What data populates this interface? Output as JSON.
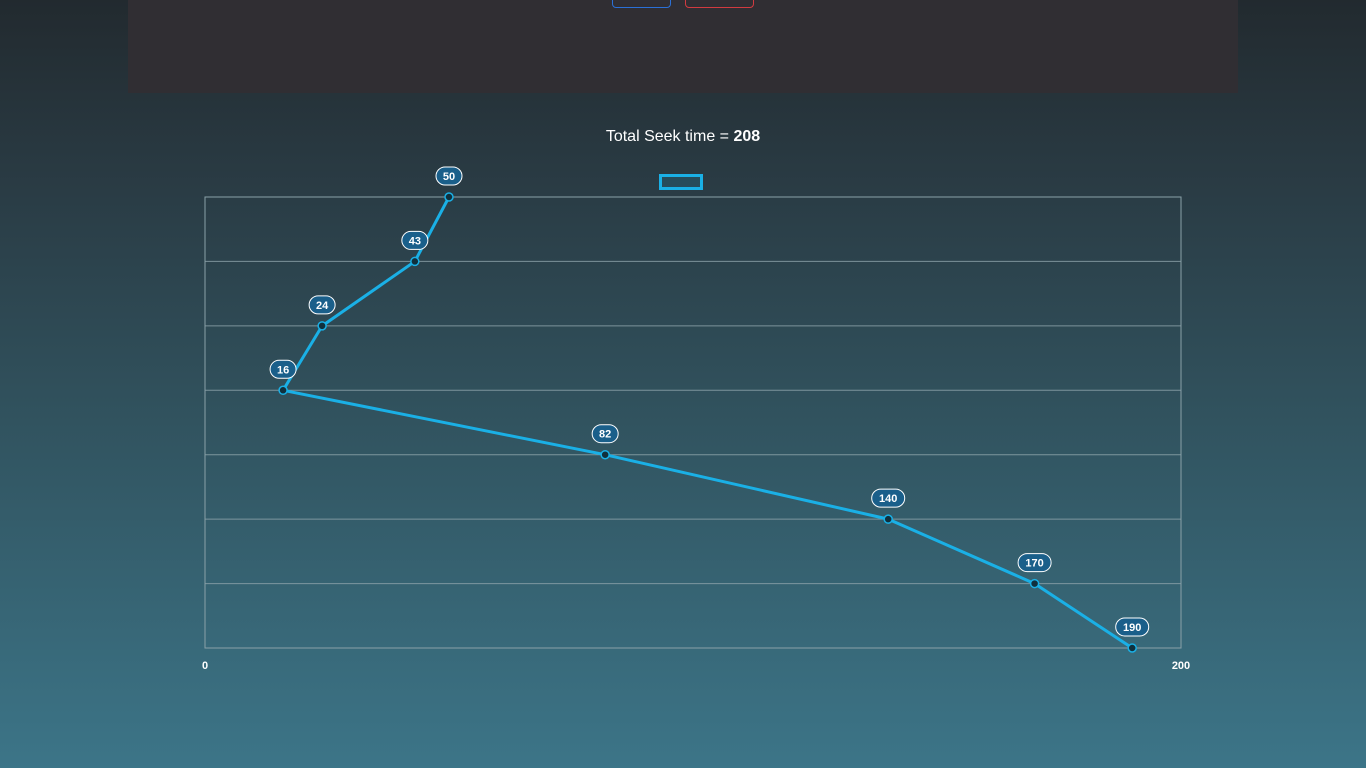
{
  "header": {
    "total_label": "Total Seek time = ",
    "total_value": "208"
  },
  "colors": {
    "line": "#1ab0e6",
    "label_bg": "#1a5f8a",
    "grid": "#8aa1a8",
    "point": "#10303d"
  },
  "chart_data": {
    "type": "line",
    "title": "",
    "xlabel": "",
    "ylabel": "",
    "xlim": [
      0,
      200
    ],
    "x_ticks": [
      "0",
      "200"
    ],
    "grid": true,
    "legend": "top-center",
    "series": [
      {
        "points": [
          {
            "step": 0,
            "x": 50
          },
          {
            "step": 1,
            "x": 43
          },
          {
            "step": 2,
            "x": 24
          },
          {
            "step": 3,
            "x": 16
          },
          {
            "step": 4,
            "x": 82
          },
          {
            "step": 5,
            "x": 140
          },
          {
            "step": 6,
            "x": 170
          },
          {
            "step": 7,
            "x": 190
          }
        ]
      }
    ]
  }
}
